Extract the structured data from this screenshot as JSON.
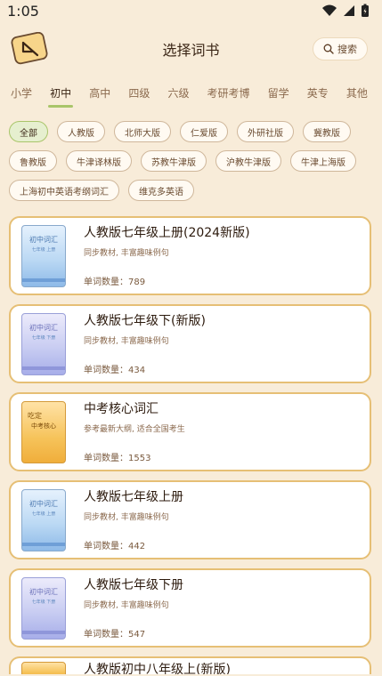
{
  "status": {
    "time": "1:05"
  },
  "header": {
    "title": "选择词书",
    "search_label": "搜索"
  },
  "tabs": [
    {
      "label": "小学"
    },
    {
      "label": "初中"
    },
    {
      "label": "高中"
    },
    {
      "label": "四级"
    },
    {
      "label": "六级"
    },
    {
      "label": "考研考博"
    },
    {
      "label": "留学"
    },
    {
      "label": "英专"
    },
    {
      "label": "其他"
    }
  ],
  "active_tab": "初中",
  "chips": [
    {
      "label": "全部"
    },
    {
      "label": "人教版"
    },
    {
      "label": "北师大版"
    },
    {
      "label": "仁爱版"
    },
    {
      "label": "外研社版"
    },
    {
      "label": "冀教版"
    },
    {
      "label": "鲁教版"
    },
    {
      "label": "牛津译林版"
    },
    {
      "label": "苏教牛津版"
    },
    {
      "label": "沪教牛津版"
    },
    {
      "label": "牛津上海版"
    },
    {
      "label": "上海初中英语考纲词汇"
    },
    {
      "label": "维克多英语"
    }
  ],
  "active_chip": "全部",
  "books": [
    {
      "title": "人教版七年级上册(2024新版)",
      "desc": "同步教材, 丰富趣味例句",
      "count_label": "单词数量：789",
      "cover_title": "初中词汇",
      "cover_sub": "七年级 上册",
      "cover_color": "blue"
    },
    {
      "title": "人教版七年级下(新版)",
      "desc": "同步教材, 丰富趣味例句",
      "count_label": "单词数量：434",
      "cover_title": "初中词汇",
      "cover_sub": "七年级 下册",
      "cover_color": "purple"
    },
    {
      "title": "中考核心词汇",
      "desc": "参考最新大纲, 适合全国考生",
      "count_label": "单词数量：1553",
      "cover_title": "吃定",
      "cover_sub": "中考核心",
      "cover_color": "orange"
    },
    {
      "title": "人教版七年级上册",
      "desc": "同步教材, 丰富趣味例句",
      "count_label": "单词数量：442",
      "cover_title": "初中词汇",
      "cover_sub": "七年级 上册",
      "cover_color": "blue"
    },
    {
      "title": "人教版七年级下册",
      "desc": "同步教材, 丰富趣味例句",
      "count_label": "单词数量：547",
      "cover_title": "初中词汇",
      "cover_sub": "七年级 下册",
      "cover_color": "purple"
    },
    {
      "title": "人教版初中八年级上(新版)",
      "desc": "",
      "count_label": "",
      "cover_title": "",
      "cover_sub": "",
      "cover_color": "orange"
    }
  ],
  "colors": {
    "background": "#f8ecd9",
    "card_border": "#e6bf75",
    "accent": "#a9c56a"
  }
}
